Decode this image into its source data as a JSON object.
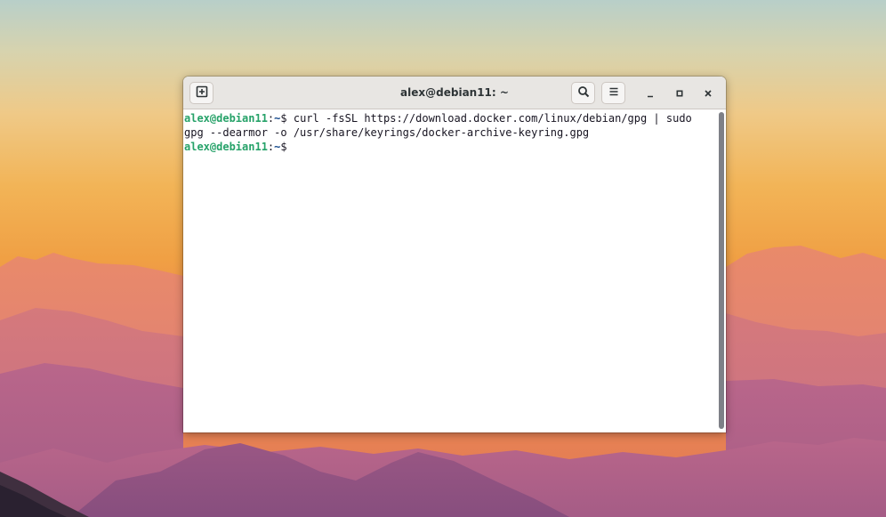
{
  "window": {
    "title": "alex@debian11: ~"
  },
  "headerbar": {
    "new_tab_icon": "new-tab-icon",
    "search_icon": "search-icon",
    "menu_icon": "hamburger-menu-icon",
    "minimize_icon": "minimize-icon",
    "maximize_icon": "maximize-icon",
    "close_icon": "close-icon"
  },
  "terminal": {
    "lines": [
      {
        "user_host": "alex@debian11",
        "colon": ":",
        "path": "~",
        "symbol": "$",
        "command": " curl -fsSL https://download.docker.com/linux/debian/gpg | sudo"
      },
      {
        "text": "gpg --dearmor -o /usr/share/keyrings/docker-archive-keyring.gpg"
      },
      {
        "user_host": "alex@debian11",
        "colon": ":",
        "path": "~",
        "symbol": "$",
        "command": ""
      }
    ]
  },
  "colors": {
    "prompt_user": "#26a269",
    "prompt_path": "#12488b",
    "terminal_fg": "#171421",
    "terminal_bg": "#ffffff",
    "headerbar_bg": "#e8e6e3"
  }
}
